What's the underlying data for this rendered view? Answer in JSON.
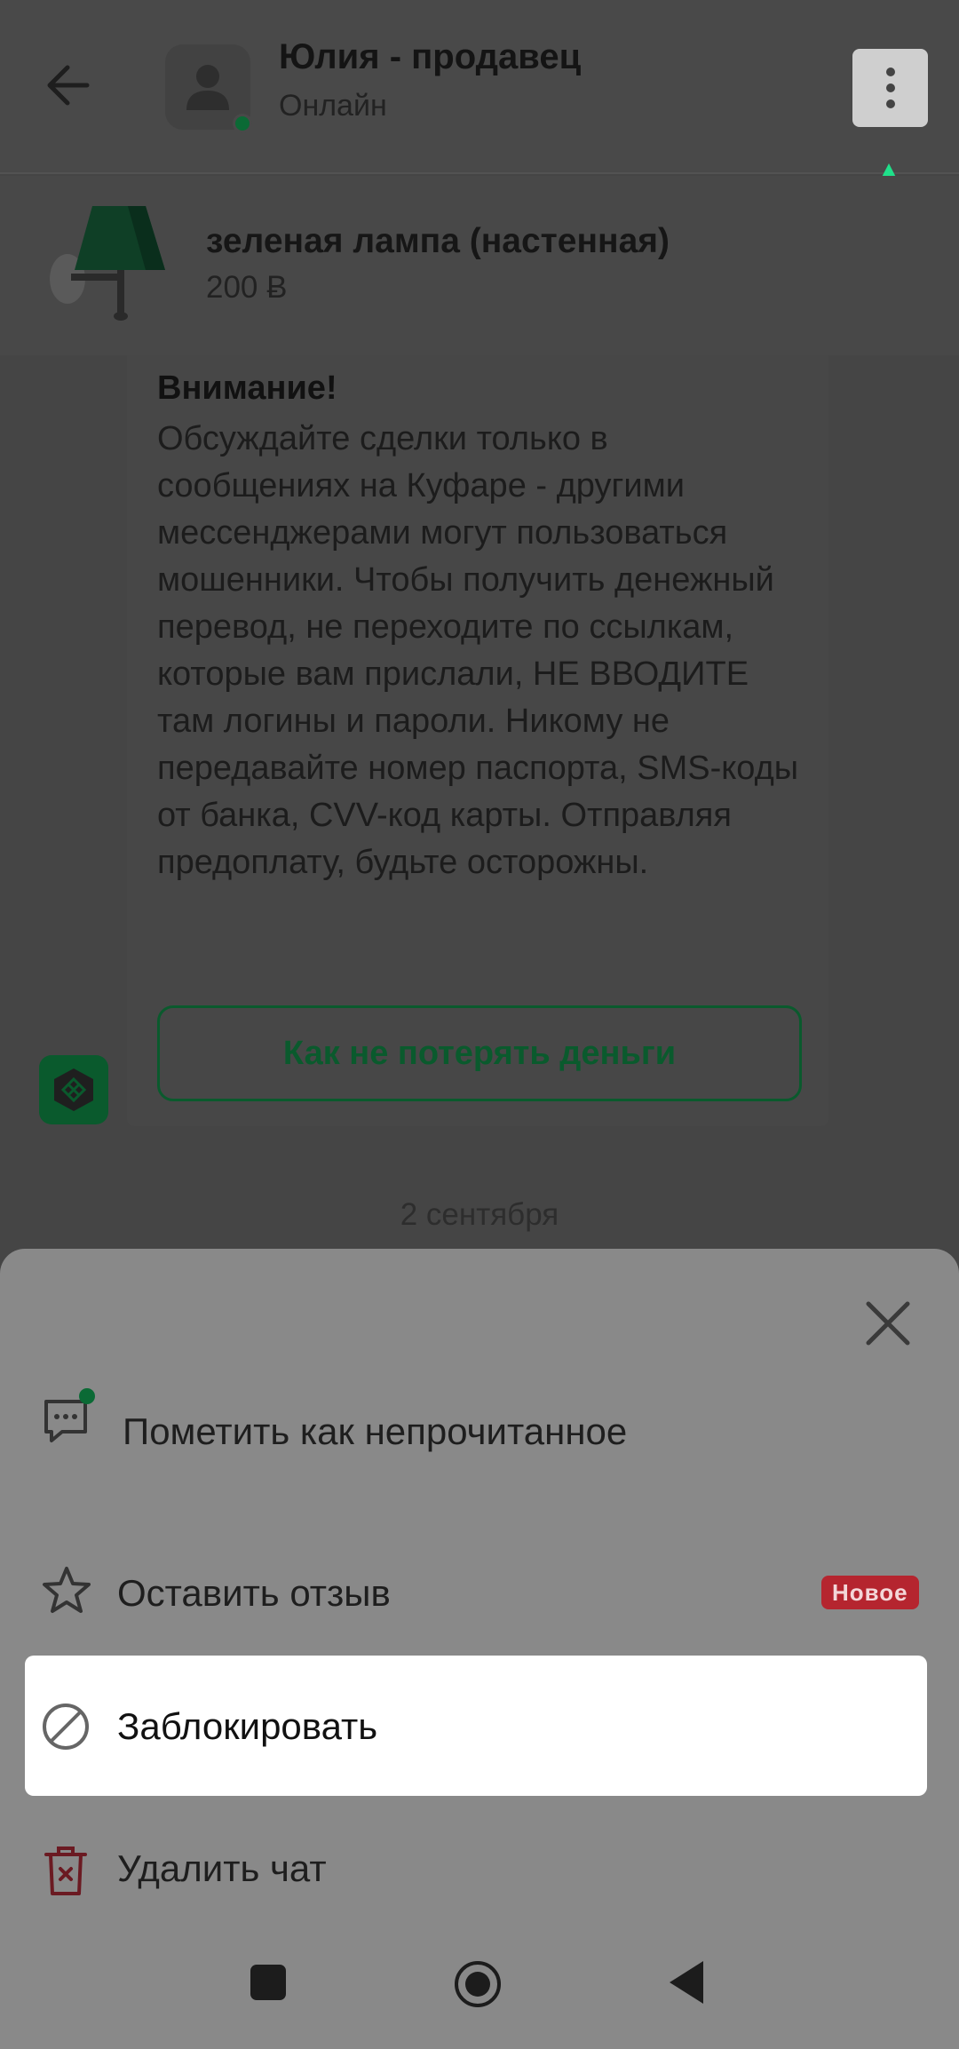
{
  "header": {
    "seller_name": "Юлия - продавец",
    "status": "Онлайн"
  },
  "product": {
    "title": "зеленая лампа (настенная)",
    "price": "200 Ƀ"
  },
  "warning": {
    "title": "Внимание!",
    "body": "Обсуждайте сделки только в сообщениях на Куфаре - другими мессенджерами могут пользоваться мошенники. Чтобы получить денежный перевод, не переходите по ссылкам, которые вам прислали, НЕ ВВОДИТЕ там логины и пароли. Никому не передавайте номер паспорта, SMS-коды от банка, CVV-код карты. Отправляя предоплату, будьте осторожны.",
    "link_label": "Как не потерять деньги"
  },
  "date_separator": "2 сентября",
  "sheet": {
    "items": [
      {
        "label": "Пометить как непрочитанное",
        "icon": "chat-unread-icon"
      },
      {
        "label": "Оставить отзыв",
        "icon": "star-icon",
        "badge": "Новое"
      },
      {
        "label": "Заблокировать",
        "icon": "block-icon"
      },
      {
        "label": "Удалить чат",
        "icon": "trash-icon"
      }
    ]
  },
  "colors": {
    "accent_green": "#0a5a2d",
    "hint_arrow": "#1fe08a",
    "badge_red": "#b5252f"
  }
}
